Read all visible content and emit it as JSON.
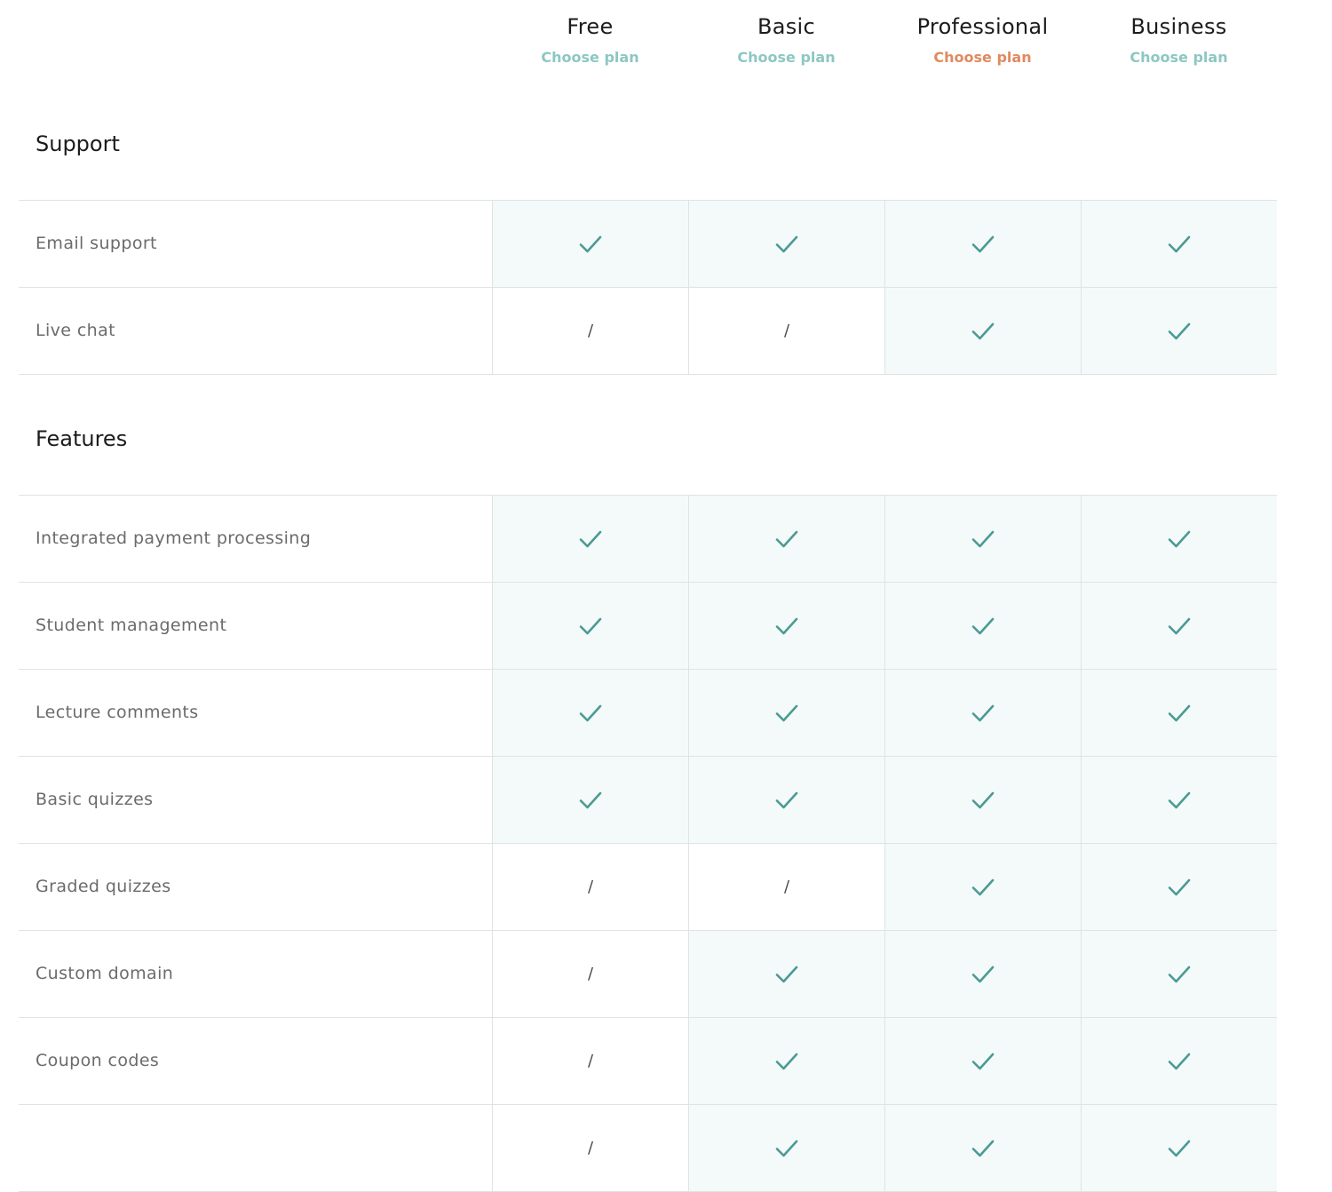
{
  "plans": [
    {
      "name": "Free",
      "cta": "Choose plan",
      "highlight": false
    },
    {
      "name": "Basic",
      "cta": "Choose plan",
      "highlight": false
    },
    {
      "name": "Professional",
      "cta": "Choose plan",
      "highlight": true
    },
    {
      "name": "Business",
      "cta": "Choose plan",
      "highlight": false
    }
  ],
  "colors": {
    "cta_default": "#8cc7c3",
    "cta_highlight": "#e08a60",
    "check": "#4a9b93",
    "included_bg": "#f4f9f9",
    "border": "#dfe3e4"
  },
  "icons": {
    "included": "check-icon",
    "not_included": "dash-icon",
    "not_included_glyph": "/"
  },
  "sections": [
    {
      "title": "Support",
      "rows": [
        {
          "label": "Email support",
          "values": [
            true,
            true,
            true,
            true
          ]
        },
        {
          "label": "Live chat",
          "values": [
            false,
            false,
            true,
            true
          ]
        }
      ]
    },
    {
      "title": "Features",
      "rows": [
        {
          "label": "Integrated payment processing",
          "values": [
            true,
            true,
            true,
            true
          ]
        },
        {
          "label": "Student management",
          "values": [
            true,
            true,
            true,
            true
          ]
        },
        {
          "label": "Lecture comments",
          "values": [
            true,
            true,
            true,
            true
          ]
        },
        {
          "label": "Basic quizzes",
          "values": [
            true,
            true,
            true,
            true
          ]
        },
        {
          "label": "Graded quizzes",
          "values": [
            false,
            false,
            true,
            true
          ]
        },
        {
          "label": "Custom domain",
          "values": [
            false,
            true,
            true,
            true
          ]
        },
        {
          "label": "Coupon codes",
          "values": [
            false,
            true,
            true,
            true
          ]
        },
        {
          "label": "",
          "values": [
            false,
            true,
            true,
            true
          ]
        }
      ]
    }
  ]
}
